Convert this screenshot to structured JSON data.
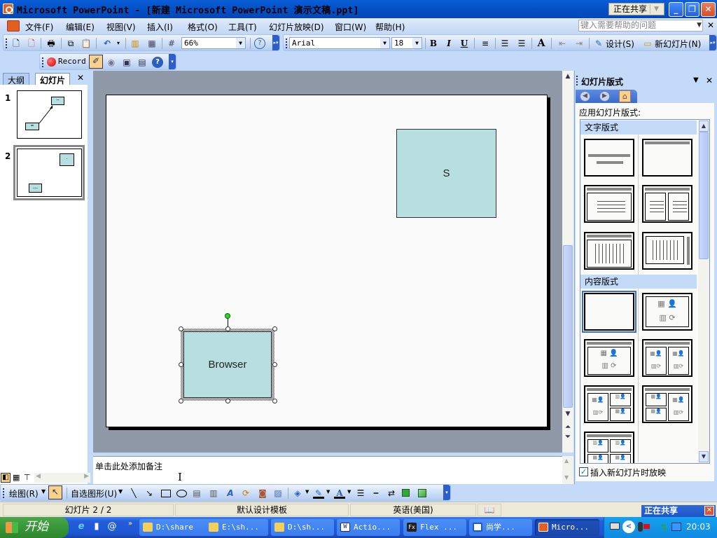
{
  "window": {
    "title": "Microsoft PowerPoint - [新建 Microsoft PowerPoint 演示文稿.ppt]",
    "sharing_label": "正在共享",
    "minimize": "_",
    "restore": "❐",
    "close": "✕"
  },
  "menu": {
    "items": [
      "文件(F)",
      "编辑(E)",
      "视图(V)",
      "插入(I)",
      "格式(O)",
      "工具(T)",
      "幻灯片放映(D)",
      "窗口(W)",
      "帮助(H)"
    ],
    "help_placeholder": "键入需要帮助的问题"
  },
  "standard_toolbar": {
    "zoom": "66%"
  },
  "format_toolbar": {
    "font": "Arial",
    "size": "18",
    "bold": "B",
    "italic": "I",
    "underline": "U",
    "design_label": "设计(S)",
    "new_slide_label": "新幻灯片(N)"
  },
  "record_toolbar": {
    "record_label": "Record"
  },
  "left_pane": {
    "tabs": [
      "大纲",
      "幻灯片"
    ],
    "active_tab": "幻灯片",
    "slides": [
      {
        "number": "1",
        "shapes": [
          "--",
          "="
        ]
      },
      {
        "number": "2",
        "shapes": [
          "·",
          "---"
        ]
      }
    ]
  },
  "slide": {
    "shapes": [
      {
        "name": "S",
        "text": "S",
        "selected": false
      },
      {
        "name": "Browser",
        "text": "Browser",
        "selected": true
      }
    ]
  },
  "notes": {
    "placeholder": "单击此处添加备注"
  },
  "task_pane": {
    "title": "幻灯片版式",
    "apply_label": "应用幻灯片版式:",
    "categories": [
      "文字版式",
      "内容版式"
    ],
    "checkbox_label": "插入新幻灯片时放映",
    "checkbox_checked": true
  },
  "draw_toolbar": {
    "draw_label": "绘图(R)",
    "autoshapes_label": "自选图形(U)"
  },
  "status_bar": {
    "slide_info": "幻灯片 2 / 2",
    "template": "默认设计模板",
    "language": "英语(美国)"
  },
  "sharing_popup": {
    "label": "正在共享"
  },
  "taskbar": {
    "start_label": "开始",
    "buttons": [
      {
        "label": "D:\\share",
        "icon": "folder-icon"
      },
      {
        "label": "E:\\sh...",
        "icon": "folder-icon"
      },
      {
        "label": "D:\\sh...",
        "icon": "folder-icon"
      },
      {
        "label": "Actio...",
        "icon": "word-icon"
      },
      {
        "label": "Flex ...",
        "icon": "flex-icon"
      },
      {
        "label": "尚学...",
        "icon": "app-icon"
      },
      {
        "label": "Micro...",
        "icon": "powerpoint-icon",
        "active": true
      }
    ],
    "clock": "20:03"
  }
}
